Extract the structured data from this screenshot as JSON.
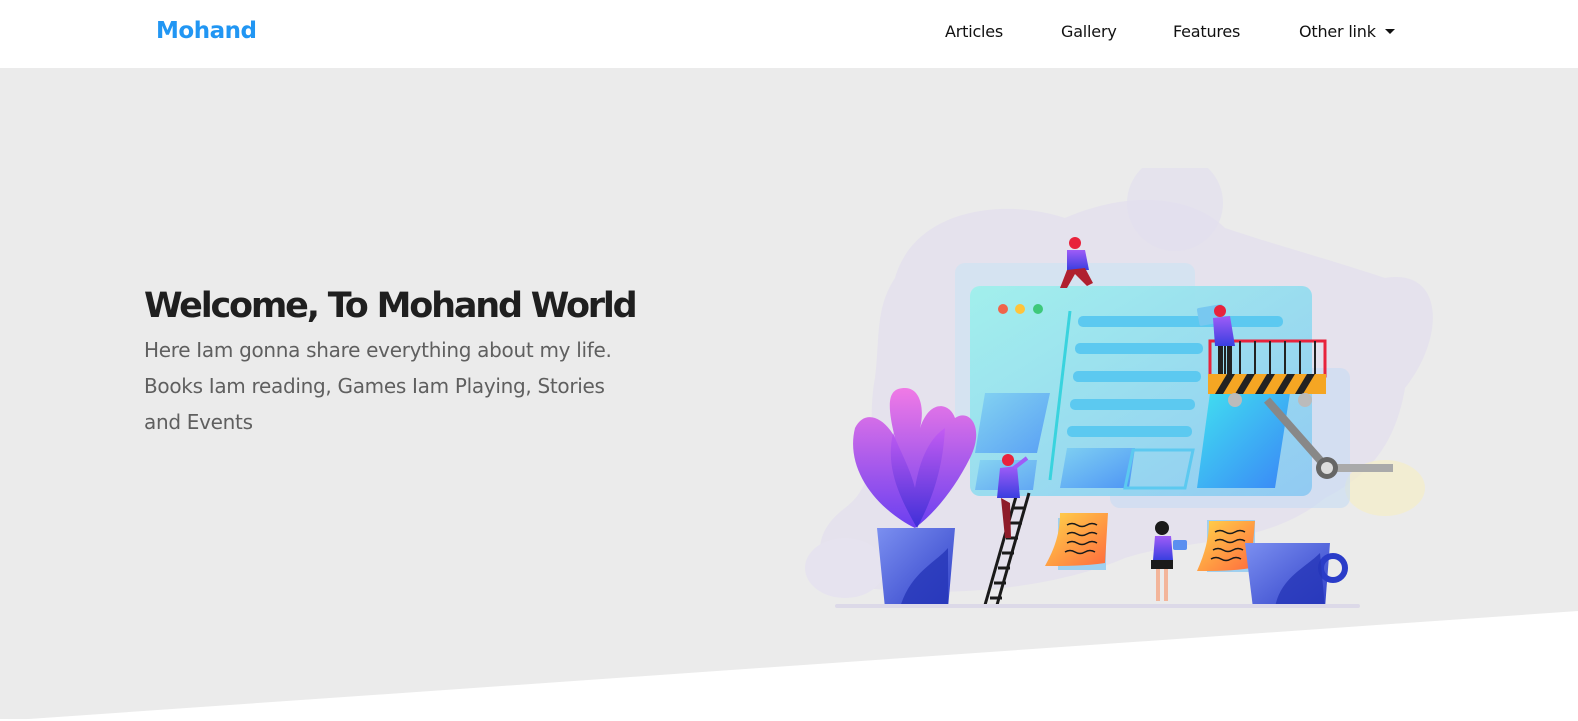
{
  "navbar": {
    "brand": "Mohand",
    "links": [
      "Articles",
      "Gallery",
      "Features",
      "Other link"
    ]
  },
  "hero": {
    "title": "Welcome, To Mohand World",
    "text": "Here Iam gonna share everything about my life. Books Iam reading, Games Iam Playing, Stories and Events"
  },
  "colors": {
    "brand": "#2196f3",
    "hero_background": "#ebebeb",
    "navbar_background": "#ffffff"
  },
  "icons": [
    "dropdown-caret-icon"
  ]
}
